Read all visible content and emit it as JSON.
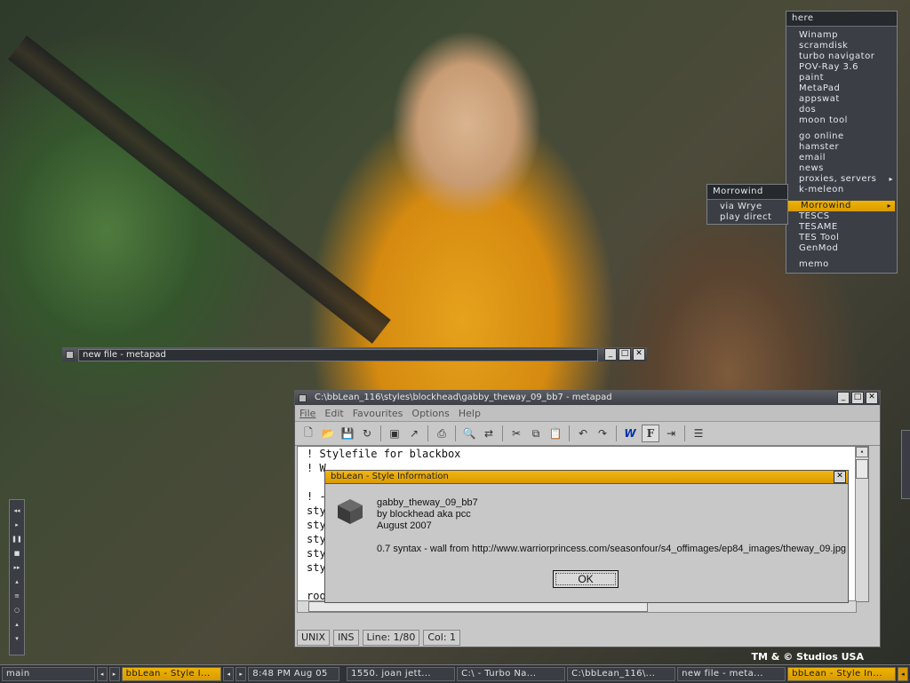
{
  "wallpaper": {
    "logo": "TM & © Studios USA"
  },
  "menu_here": {
    "title": "here",
    "groups": [
      [
        "Winamp",
        "scramdisk",
        "turbo navigator",
        "POV-Ray 3.6",
        "paint",
        "MetaPad",
        "appswat",
        "dos",
        "moon tool"
      ],
      [
        "go online",
        "hamster",
        "email",
        "news",
        "proxies, servers",
        "k-meleon"
      ],
      [
        "Morrowind",
        "TESCS",
        "TESAME",
        "TES Tool",
        "GenMod"
      ],
      [
        "memo"
      ]
    ],
    "submenu_indicator": "▸"
  },
  "menu_morrowind": {
    "title": "Morrowind",
    "items": [
      "via Wrye",
      "play direct"
    ]
  },
  "win_newfile": {
    "title": "new file - metapad"
  },
  "win_metapad": {
    "title": "C:\\bbLean_116\\styles\\blockhead\\gabby_theway_09_bb7 - metapad",
    "menus": [
      "File",
      "Edit",
      "Favourites",
      "Options",
      "Help"
    ],
    "lines": [
      "! Stylefile for blackbox",
      "! W",
      "",
      "! -",
      "sty",
      "sty",
      "sty",
      "sty",
      "sty                                                      /se",
      "",
      "rootcommand: bsetbg -full  /backgrounds/theway 09.jpg"
    ],
    "status": {
      "eol": "UNIX",
      "mode": "INS",
      "line": "Line: 1/80",
      "col": "Col: 1"
    }
  },
  "dialog": {
    "title": "bbLean - Style Information",
    "style_name": "gabby_theway_09_bb7",
    "author": "by blockhead aka pcc",
    "date": "August 2007",
    "note": "0.7 syntax - wall from http://www.warriorprincess.com/seasonfour/s4_offimages/ep84_images/theway_09.jpg",
    "ok_label": "OK"
  },
  "taskbar": {
    "workspace": "main",
    "current": "bbLean - Style I...",
    "clock": "8:48 PM Aug 05",
    "tasks": [
      "1550. joan jett...",
      "C:\\ - Turbo Na...",
      "C:\\bbLean_116\\...",
      "new file - meta...",
      "bbLean - Style In..."
    ]
  },
  "colors": {
    "accent": "#e0a400",
    "chrome": "#3b3f45"
  }
}
